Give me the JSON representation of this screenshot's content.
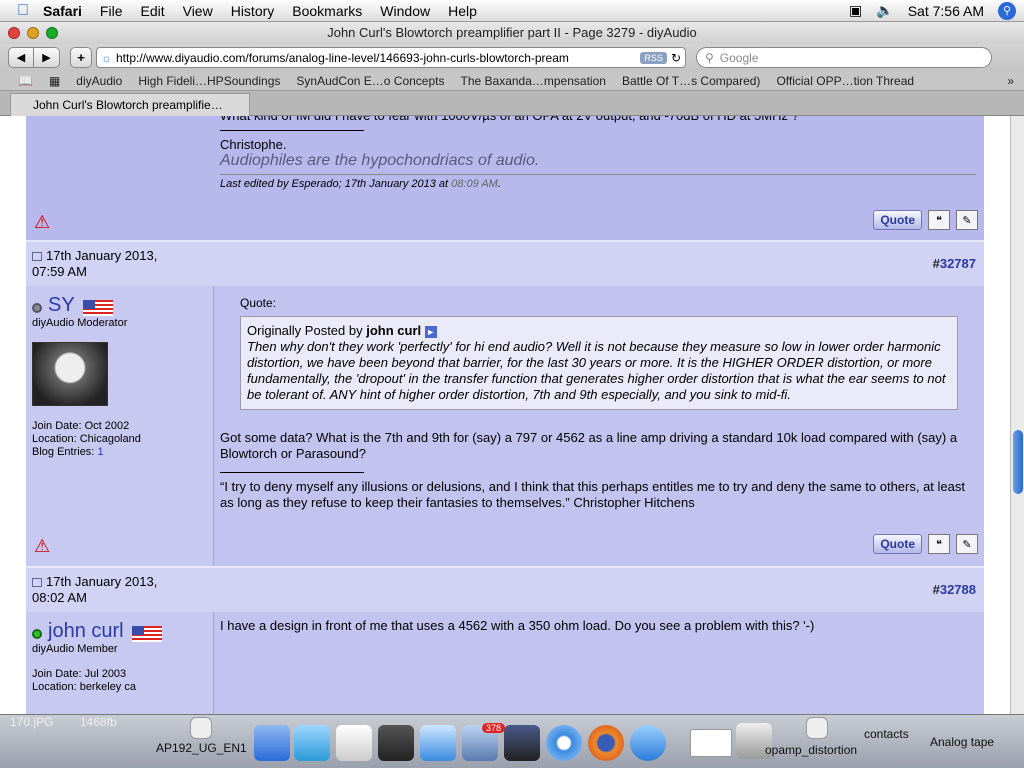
{
  "menubar": {
    "app": "Safari",
    "items": [
      "File",
      "Edit",
      "View",
      "History",
      "Bookmarks",
      "Window",
      "Help"
    ],
    "clock": "Sat 7:56 AM"
  },
  "window": {
    "title": "John Curl's Blowtorch preamplifier part II - Page 3279 - diyAudio"
  },
  "toolbar": {
    "url": "http://www.diyaudio.com/forums/analog-line-level/146693-john-curls-blowtorch-pream",
    "rss": "RSS",
    "search_placeholder": "Google"
  },
  "bookmarks": [
    "diyAudio",
    "High Fideli…HPSoundings",
    "SynAudCon E…o Concepts",
    "The Baxanda…mpensation",
    "Battle Of T…s Compared)",
    "Official OPP…tion Thread"
  ],
  "tab": {
    "label": "John Curl's Blowtorch preamplifie…"
  },
  "prev_post": {
    "cut_text": "What kind of IM did I have to fear with 1000V/µs of an OPA at 2V output, and -70dB of HD at 5MHz ?",
    "sig_name": "Christophe.",
    "sig_tagline": "Audiophiles are the hypochondriacs of audio.",
    "edited": "Last edited by Esperado; 17th January 2013 at",
    "edited_time": "08:09 AM",
    "edited_period": "."
  },
  "posts": [
    {
      "date_line1": "17th January 2013,",
      "date_line2": "07:59 AM",
      "hash": "#",
      "number": "32787",
      "user": "SY",
      "role": "diyAudio Moderator",
      "join": "Join Date: Oct 2002",
      "location": "Location: Chicagoland",
      "blog_label": "Blog Entries:",
      "blog_count": "1",
      "quote_label": "Quote:",
      "quote_intro": "Originally Posted by",
      "quote_author": "john curl",
      "quote_text": "Then why don't they work 'perfectly' for hi end audio? Well it is not because they measure so low in lower order harmonic distortion, we have been beyond that barrier, for the last 30 years or more. It is the HIGHER ORDER distortion, or more fundamentally, the 'dropout' in the transfer function that generates higher order distortion that is what the ear seems to not be tolerant of. ANY hint of higher order distortion, 7th and 9th especially, and you sink to mid-fi.",
      "body": "Got some data? What is the 7th and 9th for (say) a 797 or 4562 as a line amp driving a standard 10k load compared with (say) a Blowtorch or Parasound?",
      "signature": "“I try to deny myself any illusions or delusions, and I think that this perhaps entitles me to try and deny the same to others, at least as long as they refuse to keep their fantasies to themselves.” Christopher Hitchens",
      "quote_button": "Quote"
    },
    {
      "date_line1": "17th January 2013,",
      "date_line2": "08:02 AM",
      "hash": "#",
      "number": "32788",
      "user": "john curl",
      "role": "diyAudio Member",
      "join": "Join Date: Jul 2003",
      "location": "Location: berkeley ca",
      "body": "I have a design in front of me that uses a 4562 with a 350 ohm load. Do you see a problem with this? '-)"
    }
  ],
  "dock": {
    "left_label_1": "170.jPG",
    "left_label_2": "1468fb",
    "file1": "AP192_UG_EN1",
    "file2": "opamp_distortion",
    "file3": "contacts",
    "file4": "Analog tape",
    "mail_badge": "378"
  }
}
